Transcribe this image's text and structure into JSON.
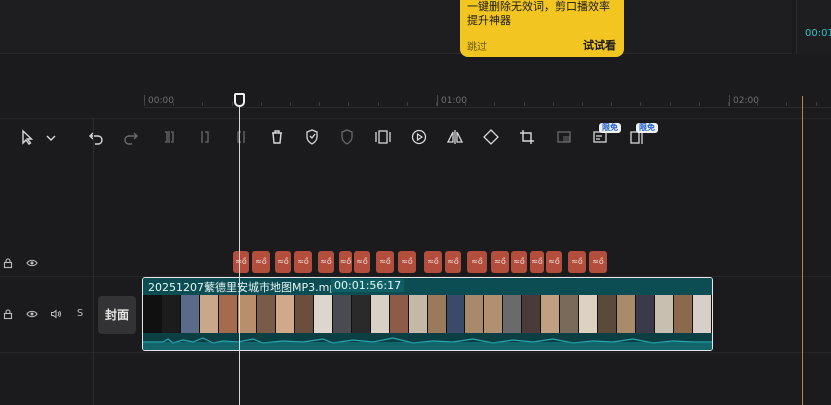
{
  "top_panel": {
    "time_display": "00:01"
  },
  "tip": {
    "line1": "一键删除无效词，剪口播效率",
    "line2": "提升神器",
    "skip_label": "跳过",
    "try_label": "试试看"
  },
  "toolbar": {
    "badge_free_1": "限免",
    "badge_free_2": "限免"
  },
  "ruler": {
    "labels": [
      "00:00",
      "01:00",
      "02:00"
    ]
  },
  "track": {
    "cover_label": "封面",
    "solo_label": "S"
  },
  "markers": {
    "label": "≈ő"
  },
  "clip": {
    "name": "20251207蘩德里安城市地图MP3.mp4",
    "duration": "00:01:56:17"
  },
  "thumbnail_colors": [
    "#101010",
    "#1c1c1c",
    "#5a6b8a",
    "#c9a78a",
    "#a56b4f",
    "#b88e6d",
    "#7a5b4a",
    "#cfa98a",
    "#6b4f3d",
    "#ddd6cf",
    "#4a4a52",
    "#2a2a2a",
    "#d9d0c5",
    "#8e5a4a",
    "#c5b8a8",
    "#9a7a5a",
    "#3b4a6b",
    "#a88a6a",
    "#b09070",
    "#6a6a6a",
    "#4a3a3a",
    "#c0a080",
    "#7a6a5a",
    "#ddd2c2",
    "#5a4a3a",
    "#a98b6b",
    "#3a3a4a",
    "#c8bfb0",
    "#8a6a4a",
    "#d8d0c8"
  ]
}
